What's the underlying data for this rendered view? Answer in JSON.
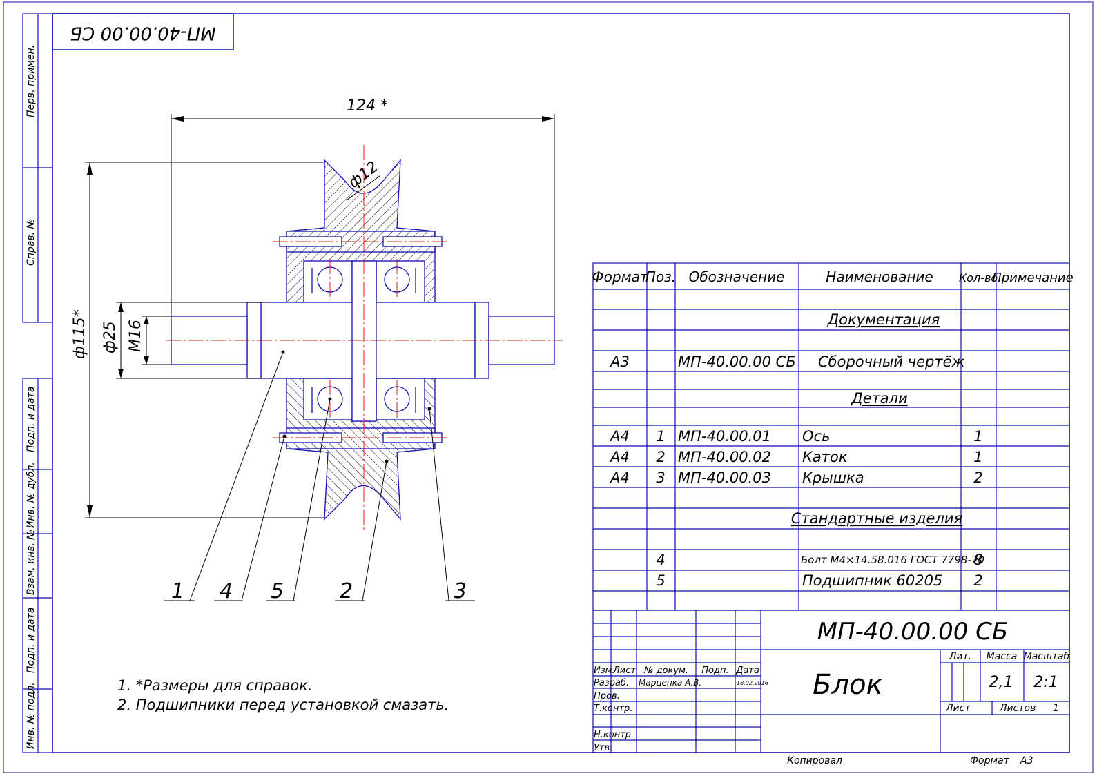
{
  "stamp": {
    "mirror_code": "МП-40.00.00 СБ"
  },
  "side_labels": [
    "Перв. примен.",
    "Справ. №",
    "Подп. и дата",
    "Инв. № дубл.",
    "Взам. инв. №",
    "Подп. и дата",
    "Инв. № подл."
  ],
  "dimensions": {
    "length": "124 *",
    "outer_diameter": "ф115*",
    "shaft_diameter": "ф25",
    "thread": "M16",
    "groove": "ф12"
  },
  "callouts": [
    "1",
    "4",
    "5",
    "2",
    "3"
  ],
  "notes": [
    "1.  *Размеры для справок.",
    "2.  Подшипники перед установкой смазать."
  ],
  "spec": {
    "headers": [
      "Формат",
      "Поз.",
      "Обозначение",
      "Наименование",
      "Кол-во",
      "Примечание"
    ],
    "rows": [
      {
        "format": "",
        "pos": "",
        "code": "",
        "name": "",
        "qty": "",
        "note": "",
        "section": false
      },
      {
        "format": "",
        "pos": "",
        "code": "",
        "name": "Документация",
        "qty": "",
        "note": "",
        "section": true
      },
      {
        "format": "",
        "pos": "",
        "code": "",
        "name": "",
        "qty": "",
        "note": "",
        "section": false
      },
      {
        "format": "А3",
        "pos": "",
        "code": "МП-40.00.00 СБ",
        "name": "Сборочный чертёж",
        "qty": "",
        "note": "",
        "section": false
      },
      {
        "format": "",
        "pos": "",
        "code": "",
        "name": "Детали",
        "qty": "",
        "note": "",
        "section": true
      },
      {
        "format": "",
        "pos": "",
        "code": "",
        "name": "",
        "qty": "",
        "note": "",
        "section": false
      },
      {
        "format": "А4",
        "pos": "1",
        "code": "МП-40.00.01",
        "name": "Ось",
        "qty": "1",
        "note": "",
        "section": false
      },
      {
        "format": "А4",
        "pos": "2",
        "code": "МП-40.00.02",
        "name": "Каток",
        "qty": "1",
        "note": "",
        "section": false
      },
      {
        "format": "А4",
        "pos": "3",
        "code": "МП-40.00.03",
        "name": "Крышка",
        "qty": "2",
        "note": "",
        "section": false
      },
      {
        "format": "",
        "pos": "",
        "code": "",
        "name": "",
        "qty": "",
        "note": "",
        "section": false
      },
      {
        "format": "",
        "pos": "",
        "code": "",
        "name": "Стандартные изделия",
        "qty": "",
        "note": "",
        "section": true
      },
      {
        "format": "",
        "pos": "",
        "code": "",
        "name": "",
        "qty": "",
        "note": "",
        "section": false
      },
      {
        "format": "",
        "pos": "4",
        "code": "",
        "name": "Болт М4×14.58.016 ГОСТ 7798-70",
        "qty": "8",
        "note": "",
        "section": false
      },
      {
        "format": "",
        "pos": "5",
        "code": "",
        "name": "Подшипник 60205",
        "qty": "2",
        "note": "",
        "section": false
      },
      {
        "format": "",
        "pos": "",
        "code": "",
        "name": "",
        "qty": "",
        "note": "",
        "section": false
      }
    ]
  },
  "title_block": {
    "designation": "МП-40.00.00 СБ",
    "name": "Блок",
    "col_headers": [
      "Изм.",
      "Лист",
      "№ докум.",
      "Подп.",
      "Дата"
    ],
    "row_labels": [
      "Разраб.",
      "Пров.",
      "Т.контр.",
      "",
      "Н.контр.",
      "Утв."
    ],
    "developer": "Марценка А.В.",
    "date": "18.02.2016",
    "lit_label": "Лит.",
    "mass_label": "Масса",
    "scale_label": "Масштаб",
    "mass": "2,1",
    "scale": "2:1",
    "sheet_label": "Лист",
    "sheets_label": "Листов",
    "sheets_count": "1"
  },
  "footer": {
    "copied": "Копировал",
    "format_label": "Формат",
    "format_value": "А3"
  },
  "colors": {
    "frame": "#1010b0",
    "lines": "#000000",
    "centerline": "#d02020"
  }
}
